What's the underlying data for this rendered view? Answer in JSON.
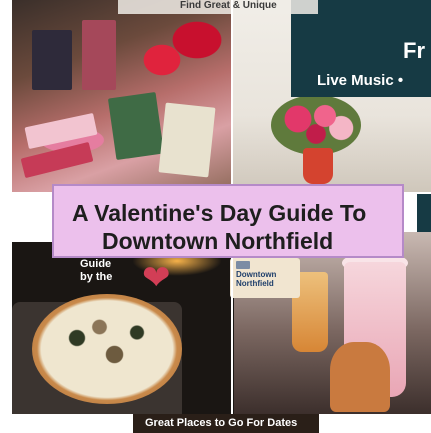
{
  "top_label": "Find Great & Unique",
  "music_panel": {
    "fragment": "Fr",
    "line": "Live Music •"
  },
  "banner": {
    "line1": "A Valentine's Day Guide To",
    "line2": "Downtown Northfield"
  },
  "badge": {
    "guide_text": [
      "Guide",
      "by the"
    ],
    "card_title": [
      "Downtown",
      "Northfield"
    ]
  },
  "caption": "Great Places to Go For Dates",
  "colors": {
    "banner_fill": "#ecc0ec",
    "banner_border": "#b58ac8",
    "music_panel": "#163a44",
    "heart": "#d23e56"
  }
}
